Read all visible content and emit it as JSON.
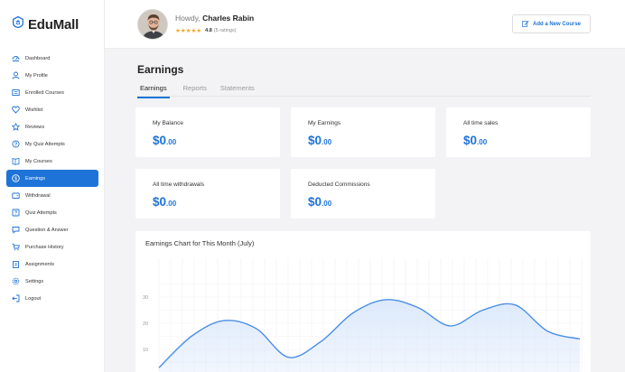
{
  "brand": {
    "name": "EduMall",
    "accent": "#1e73d8"
  },
  "sidebar": {
    "items": [
      {
        "label": "Dashboard",
        "icon": "dashboard-icon"
      },
      {
        "label": "My Profile",
        "icon": "user-icon"
      },
      {
        "label": "Enrolled Courses",
        "icon": "courses-icon"
      },
      {
        "label": "Wishlist",
        "icon": "heart-icon"
      },
      {
        "label": "Reviews",
        "icon": "star-icon"
      },
      {
        "label": "My Quiz Attempts",
        "icon": "quiz-icon"
      },
      {
        "label": "My Courses",
        "icon": "book-icon"
      },
      {
        "label": "Earnings",
        "icon": "dollar-icon",
        "active": true
      },
      {
        "label": "Withdrawal",
        "icon": "wallet-icon"
      },
      {
        "label": "Quiz Attempts",
        "icon": "question-icon"
      },
      {
        "label": "Question & Answer",
        "icon": "chat-icon"
      },
      {
        "label": "Purchase History",
        "icon": "cart-icon"
      },
      {
        "label": "Assignments",
        "icon": "clipboard-icon"
      },
      {
        "label": "Settings",
        "icon": "gear-icon"
      },
      {
        "label": "Logout",
        "icon": "logout-icon"
      }
    ]
  },
  "header": {
    "greeting": "Howdy,",
    "user_name": "Charles Rabin",
    "rating_value": "4.8",
    "rating_count": "(5 ratings)",
    "stars": "★★★★★",
    "add_course_label": "Add a New Course"
  },
  "main": {
    "title": "Earnings",
    "tabs": [
      {
        "label": "Earnings",
        "active": true
      },
      {
        "label": "Reports"
      },
      {
        "label": "Statements"
      }
    ],
    "cards": [
      {
        "label": "My Balance",
        "currency": "$0",
        "decimals": ".00"
      },
      {
        "label": "My Earnings",
        "currency": "$0",
        "decimals": ".00"
      },
      {
        "label": "All time sales",
        "currency": "$0",
        "decimals": ".00"
      },
      {
        "label": "All time withdrawals",
        "currency": "$0",
        "decimals": ".00"
      },
      {
        "label": "Deducted Commissions",
        "currency": "$0",
        "decimals": ".00"
      }
    ]
  },
  "chart_data": {
    "type": "area",
    "title": "Earnings Chart for This Month (July)",
    "y_ticks": [
      "30",
      "20",
      "10"
    ],
    "ylim": [
      0,
      35
    ],
    "series": [
      {
        "values": [
          3,
          15,
          21,
          18,
          7,
          13,
          24,
          29,
          26,
          19,
          25,
          27,
          17,
          14
        ]
      }
    ],
    "grid": true,
    "line_color": "#4a8fe7",
    "fill_color": "#dbe8fb"
  }
}
